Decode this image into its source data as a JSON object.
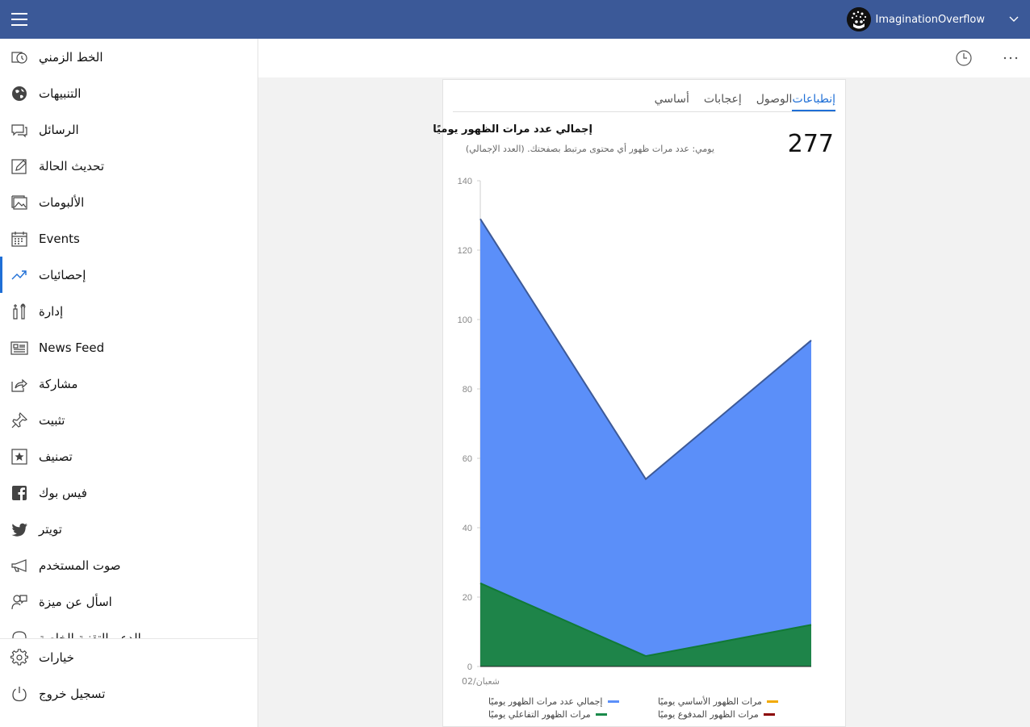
{
  "titlebar": {
    "account_name": "ImaginationOverflow",
    "color": "#3b5998"
  },
  "sidebar": {
    "items": [
      {
        "label": "الخط الزمني",
        "icon": "timeline-icon"
      },
      {
        "label": "التنبيهات",
        "icon": "globe-icon"
      },
      {
        "label": "الرسائل",
        "icon": "messages-icon"
      },
      {
        "label": "تحديث الحالة",
        "icon": "edit-icon"
      },
      {
        "label": "الألبومات",
        "icon": "albums-icon"
      },
      {
        "label": "Events",
        "icon": "calendar-icon"
      },
      {
        "label": "إحصائيات",
        "icon": "trending-icon",
        "active": true
      },
      {
        "label": "إدارة",
        "icon": "tools-icon"
      },
      {
        "label": "News Feed",
        "icon": "news-icon"
      },
      {
        "label": "مشاركة",
        "icon": "share-icon"
      },
      {
        "label": "تثبيت",
        "icon": "pin-icon"
      },
      {
        "label": "تصنيف",
        "icon": "star-icon"
      },
      {
        "label": "فيس بوك",
        "icon": "facebook-icon"
      },
      {
        "label": "تويتر",
        "icon": "twitter-icon"
      },
      {
        "label": "صوت المستخدم",
        "icon": "megaphone-icon"
      },
      {
        "label": "اسأل عن ميزة",
        "icon": "feature-request-icon"
      },
      {
        "label": "الدعم التقنية الخاصة",
        "icon": "support-icon"
      }
    ],
    "bottom": [
      {
        "label": "خيارات",
        "icon": "gear-icon"
      },
      {
        "label": "تسجيل خروج",
        "icon": "power-icon"
      }
    ]
  },
  "card": {
    "tabs": [
      {
        "label": "إنطباعات",
        "active": true
      },
      {
        "label": "الوصول"
      },
      {
        "label": "إعجابات"
      },
      {
        "label": "أساسي"
      }
    ],
    "title": "إجمالي عدد مرات الظهور يوميًا",
    "subtitle": "يومي: عدد مرات ظهور أي محتوى مرتبط بصفحتك. (العدد الإجمالي)",
    "value": "277"
  },
  "chart_data": {
    "type": "area",
    "x": [
      "02/شعبان",
      "",
      ""
    ],
    "xlabel": "",
    "ylabel": "",
    "ylim": [
      0,
      140
    ],
    "yticks": [
      0,
      20,
      40,
      60,
      80,
      100,
      120,
      140
    ],
    "grid": false,
    "legend_position": "bottom",
    "series": [
      {
        "name": "إجمالي عدد مرات الظهور يوميًا",
        "color": "#5b8ff9",
        "values": [
          129,
          54,
          94
        ]
      },
      {
        "name": "مرات الظهور الأساسي يوميًا",
        "color": "#f2a900",
        "values": [
          0,
          0,
          0
        ]
      },
      {
        "name": "مرات الظهور التفاعلي يوميًا",
        "color": "#1a8a4a",
        "values": [
          24,
          3,
          12
        ]
      },
      {
        "name": "مرات الظهور المدفوع يوميًا",
        "color": "#8b0000",
        "values": [
          0,
          0,
          0
        ]
      }
    ]
  }
}
